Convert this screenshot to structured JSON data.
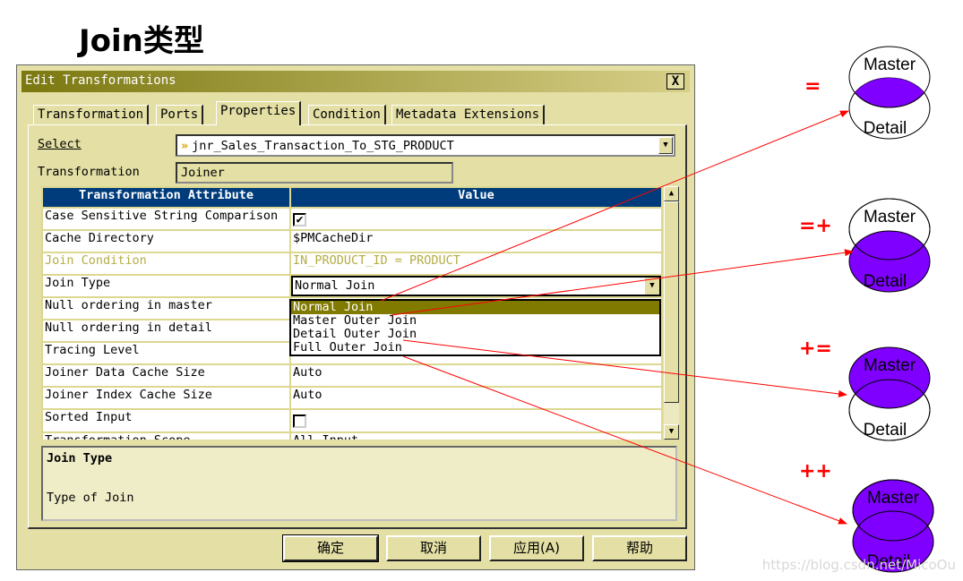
{
  "page_title": "Join类型",
  "dialog": {
    "title": "Edit Transformations",
    "close": "X",
    "tabs": [
      "Transformation",
      "Ports",
      "Properties",
      "Condition",
      "Metadata Extensions"
    ],
    "active_tab": "Properties",
    "select_label": "Select",
    "select_value": "jnr_Sales_Transaction_To_STG_PRODUCT",
    "transformation_label": "Transformation",
    "transformation_value": "Joiner",
    "grid": {
      "headers": [
        "Transformation Attribute",
        "Value"
      ],
      "rows": [
        {
          "attr": "Case Sensitive String Comparison",
          "value": "✔"
        },
        {
          "attr": "Cache Directory",
          "value": "$PMCacheDir"
        },
        {
          "attr": "Join Condition",
          "value": "IN_PRODUCT_ID = PRODUCT"
        },
        {
          "attr": "Join Type",
          "value": "Normal Join"
        },
        {
          "attr": "Null ordering in master",
          "value": ""
        },
        {
          "attr": "Null ordering in detail",
          "value": ""
        },
        {
          "attr": "Tracing Level",
          "value": ""
        },
        {
          "attr": "Joiner Data Cache Size",
          "value": "Auto"
        },
        {
          "attr": "Joiner Index Cache Size",
          "value": "Auto"
        },
        {
          "attr": "Sorted Input",
          "value": ""
        },
        {
          "attr": "Transformation Scope",
          "value": "All Input"
        }
      ]
    },
    "join_type_options": [
      "Normal Join",
      "Master Outer Join",
      "Detail Outer Join",
      "Full Outer Join"
    ],
    "selected_option": "Normal Join",
    "description": {
      "title": "Join Type",
      "text": "Type of Join"
    },
    "buttons": {
      "ok": "确定",
      "cancel": "取消",
      "apply": "应用(A)",
      "help": "帮助"
    }
  },
  "diagram": {
    "fill_color": "#7f00ff",
    "arrow_color": "#ff0000",
    "joins": [
      {
        "symbol": "=",
        "master": "Master",
        "detail": "Detail"
      },
      {
        "symbol": "=+",
        "master": "Master",
        "detail": "Detail"
      },
      {
        "symbol": "+=",
        "master": "Master",
        "detail": "Detail"
      },
      {
        "symbol": "++",
        "master": "Master",
        "detail": "Detail"
      }
    ]
  },
  "watermark": "https://blog.csdn.net/MicoOu"
}
